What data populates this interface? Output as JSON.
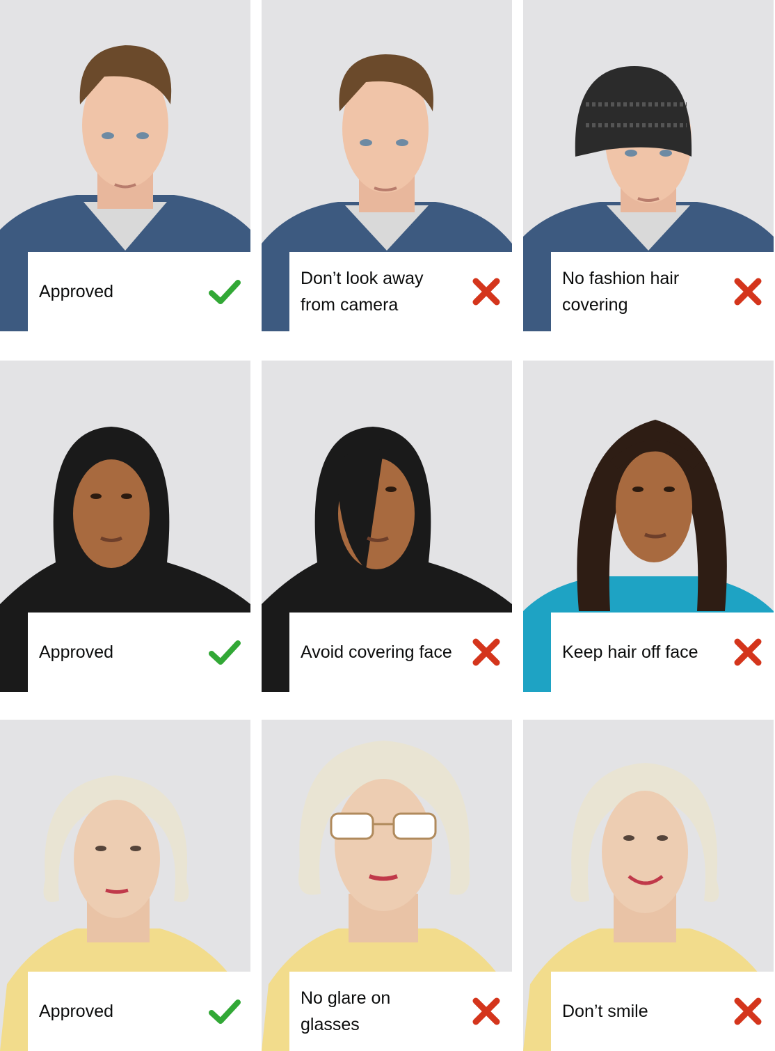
{
  "colors": {
    "approved": "#32a836",
    "rejected": "#d4351c",
    "background": "#e4e4e6",
    "text": "#0b0c0c"
  },
  "tiles": [
    {
      "caption": "Approved",
      "status": "approved",
      "icon": "check-icon"
    },
    {
      "caption": "Don’t look away from camera",
      "status": "rejected",
      "icon": "cross-icon"
    },
    {
      "caption": "No fashion hair covering",
      "status": "rejected",
      "icon": "cross-icon"
    },
    {
      "caption": "Approved",
      "status": "approved",
      "icon": "check-icon"
    },
    {
      "caption": "Avoid covering face",
      "status": "rejected",
      "icon": "cross-icon"
    },
    {
      "caption": "Keep hair off face",
      "status": "rejected",
      "icon": "cross-icon"
    },
    {
      "caption": "Approved",
      "status": "approved",
      "icon": "check-icon"
    },
    {
      "caption": "No glare on glasses",
      "status": "rejected",
      "icon": "cross-icon"
    },
    {
      "caption": "Don’t smile",
      "status": "rejected",
      "icon": "cross-icon"
    }
  ]
}
